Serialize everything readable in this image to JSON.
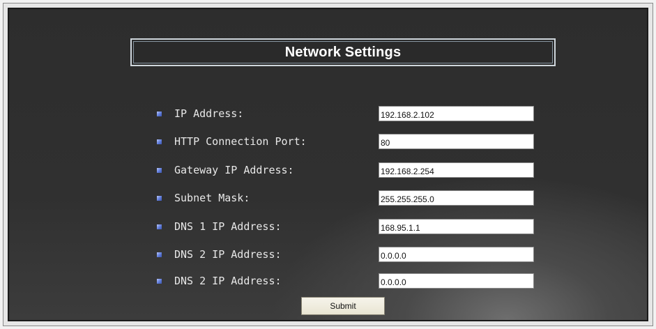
{
  "title": "Network Settings",
  "fields": [
    {
      "label": "IP Address:",
      "value": "192.168.2.102"
    },
    {
      "label": "HTTP Connection Port:",
      "value": "80"
    },
    {
      "label": "Gateway IP Address:",
      "value": "192.168.2.254"
    },
    {
      "label": "Subnet Mask:",
      "value": "255.255.255.0"
    },
    {
      "label": "DNS 1 IP Address:",
      "value": "168.95.1.1"
    },
    {
      "label": "DNS 2 IP Address:",
      "value": "0.0.0.0"
    },
    {
      "label": "DNS 2 IP Address:",
      "value": "0.0.0.0"
    }
  ],
  "submit_label": "Submit",
  "icons": {
    "bullet": "square-bullet-icon"
  },
  "colors": {
    "panel_bg": "#2d2d2d",
    "bullet": "#5f7bd9",
    "title_border": "#cfd6dc",
    "button_bg": "#eeebde"
  }
}
